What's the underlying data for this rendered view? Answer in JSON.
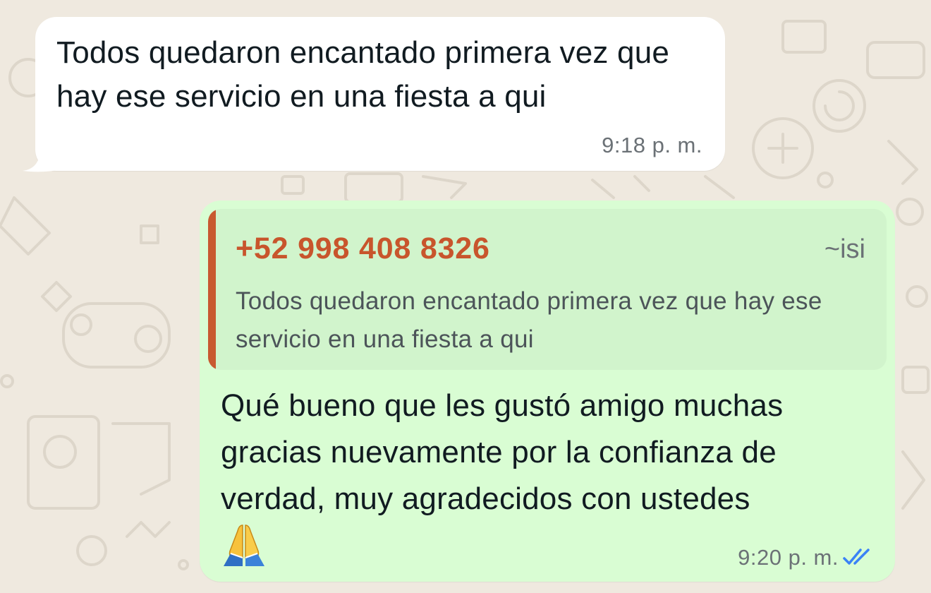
{
  "incoming": {
    "text": "Todos quedaron encantado primera vez que hay ese servicio en una fiesta a qui",
    "time": "9:18 p. m."
  },
  "outgoing": {
    "reply": {
      "author": "+52 998 408 8326",
      "push_name": "~isi",
      "text": "Todos quedaron encantado primera vez que hay ese servicio en una fiesta a qui"
    },
    "text": "Qué bueno que les gustó amigo muchas gracias nuevamente por la confianza de verdad, muy agradecidos con ustedes",
    "emoji_icon": "folded-hands-emoji",
    "time": "9:20 p. m.",
    "status_icon": "double-check-read-icon"
  },
  "colors": {
    "background": "#efe9df",
    "incoming_bubble": "#ffffff",
    "outgoing_bubble": "#d9fdd3",
    "quote_background": "#d1f4cc",
    "quote_accent": "#c8552c",
    "read_ticks": "#3b82f6"
  }
}
